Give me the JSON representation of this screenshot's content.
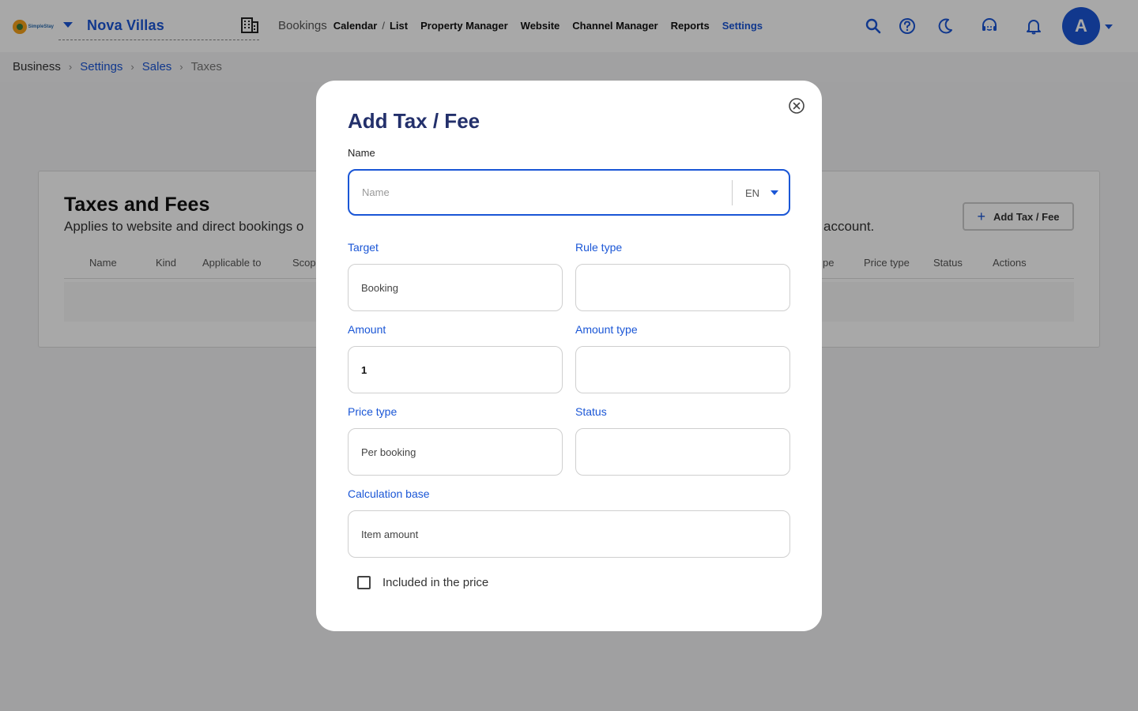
{
  "topbar": {
    "logo_text": "SimpleStay",
    "property_name": "Nova Villas",
    "nav": {
      "bookings": "Bookings",
      "calendar": "Calendar",
      "slash": "/",
      "list": "List",
      "property_manager": "Property Manager",
      "website": "Website",
      "channel_manager": "Channel Manager",
      "reports": "Reports",
      "settings": "Settings"
    },
    "avatar_initial": "A",
    "icons": [
      "search-icon",
      "help-icon",
      "moon-icon",
      "support-icon",
      "bell-icon"
    ]
  },
  "breadcrumb": {
    "items": [
      "Business",
      "Settings",
      "Sales",
      "Taxes"
    ]
  },
  "background": {
    "title": "Taxes and Fees",
    "subtitle": "Applies to website and direct bookings o",
    "subtitle_end": "account.",
    "add_button": "Add Tax / Fee",
    "columns": [
      "Name",
      "Kind",
      "Applicable to",
      "Scop",
      "pe",
      "Price type",
      "Status",
      "Actions"
    ]
  },
  "modal": {
    "title": "Add Tax / Fee",
    "name_label": "Name",
    "name_placeholder": "Name",
    "language": "EN",
    "target_label": "Target",
    "target_value": "Booking",
    "rule_type_label": "Rule type",
    "rule_type_value": "",
    "amount_label": "Amount",
    "amount_value": "1",
    "amount_type_label": "Amount type",
    "amount_type_value": "",
    "price_type_label": "Price type",
    "price_type_value": "Per booking",
    "status_label": "Status",
    "status_value": "",
    "calc_base_label": "Calculation base",
    "calc_base_value": "Item amount",
    "included_label": "Included in the price"
  },
  "colors": {
    "accent": "#1a56d6",
    "title": "#23306b"
  }
}
